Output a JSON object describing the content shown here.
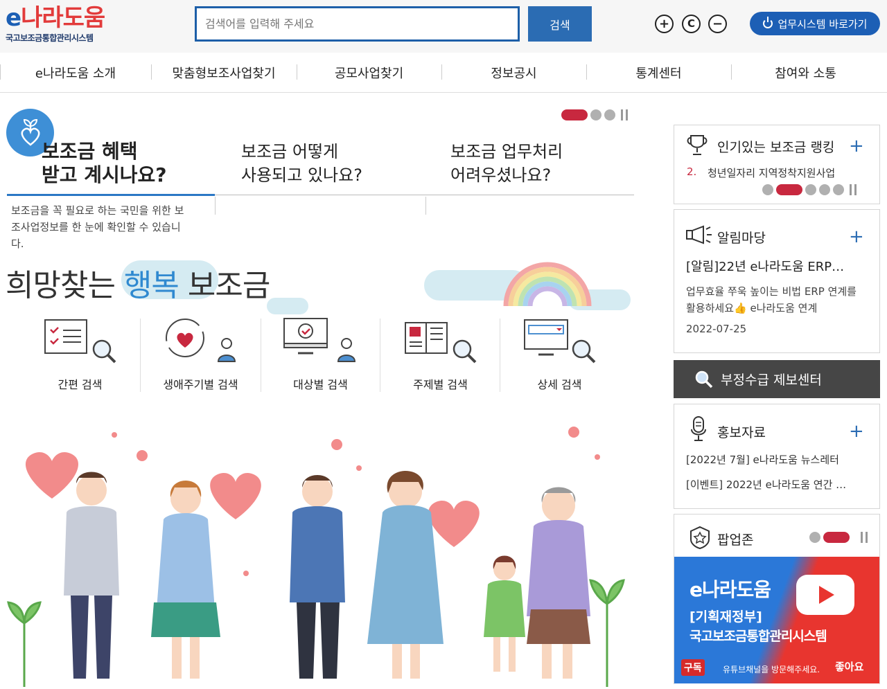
{
  "header": {
    "logo_main_e": "e",
    "logo_main_rest": "나라도움",
    "logo_sub": "국고보조금통합관리시스템",
    "search_placeholder": "검색어를 입력해 주세요",
    "search_button": "검색",
    "zoom_in": "+",
    "zoom_reset": "C",
    "zoom_out": "−",
    "system_button": "업무시스템 바로가기"
  },
  "gnb": [
    "e나라도움 소개",
    "맞춤형보조사업찾기",
    "공모사업찾기",
    "정보공시",
    "통계센터",
    "참여와 소통"
  ],
  "main": {
    "tabs": [
      {
        "line1": "보조금 혜택",
        "line2": "받고 계시나요?"
      },
      {
        "line1": "보조금 어떻게",
        "line2": "사용되고 있나요?"
      },
      {
        "line1": "보조금 업무처리",
        "line2": "어려우셨나요?"
      }
    ],
    "tab_description": "보조금을 꼭 필요로 하는 국민을 위한 보조사업정보를 한 눈에 확인할 수 있습니다.",
    "hope_pre": "희망찾는 ",
    "hope_blue": "행복",
    "hope_post": " 보조금",
    "quick_search": [
      "간편 검색",
      "생애주기별 검색",
      "대상별 검색",
      "주제별 검색",
      "상세 검색"
    ]
  },
  "ranking": {
    "title": "인기있는 보조금 랭킹",
    "number": "2.",
    "item": "청년일자리 지역정착지원사업"
  },
  "notice": {
    "title": "알림마당",
    "headline": "[알림]22년 e나라도움 ERP…",
    "body": "업무효율 쭈욱 높이는 비법 ERP 연계를 활용하세요👍 e나라도움 연계",
    "date": "2022-07-25"
  },
  "fraud": {
    "label": "부정수급 제보센터"
  },
  "promo": {
    "title": "홍보자료",
    "items": [
      "[2022년 7월] e나라도움 뉴스레터",
      "[이벤트] 2022년 e나라도움 연간 …"
    ]
  },
  "popup": {
    "title": "팝업존",
    "banner_logo": "e나라도움",
    "banner_line1": "[기획재정부]",
    "banner_line2": "국고보조금통합관리시스템",
    "banner_subscribe": "구독",
    "banner_visit": "유튜브채널을 방문해주세요.",
    "banner_like": "좋아요"
  },
  "colors": {
    "brand_blue": "#1d5fb5",
    "accent_red": "#c8283f",
    "dark_panel": "#464646"
  }
}
